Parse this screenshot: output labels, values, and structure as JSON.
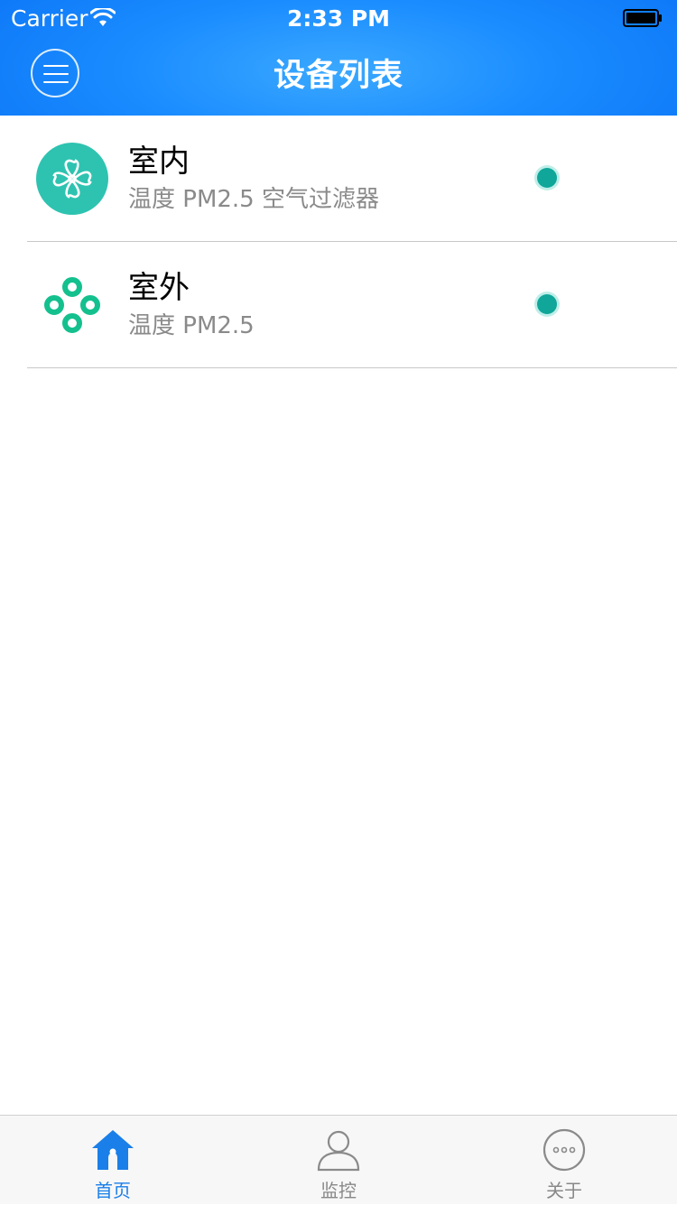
{
  "status_bar": {
    "carrier": "Carrier",
    "time": "2:33 PM"
  },
  "nav": {
    "title": "设备列表",
    "menu_icon": "menu-icon"
  },
  "devices": [
    {
      "name": "室内",
      "desc": "温度 PM2.5 空气过滤器",
      "icon": "fan-icon",
      "status_color": "#10a69a"
    },
    {
      "name": "室外",
      "desc": "温度 PM2.5",
      "icon": "sensor-ring-icon",
      "status_color": "#10a69a"
    }
  ],
  "tabs": [
    {
      "label": "首页",
      "icon": "home-icon",
      "active": true
    },
    {
      "label": "监控",
      "icon": "user-icon",
      "active": false
    },
    {
      "label": "关于",
      "icon": "more-icon",
      "active": false
    }
  ],
  "colors": {
    "header": "#1a8cff",
    "accent": "#1a7fe8",
    "teal": "#2ec3b0",
    "status_online": "#10a69a"
  }
}
